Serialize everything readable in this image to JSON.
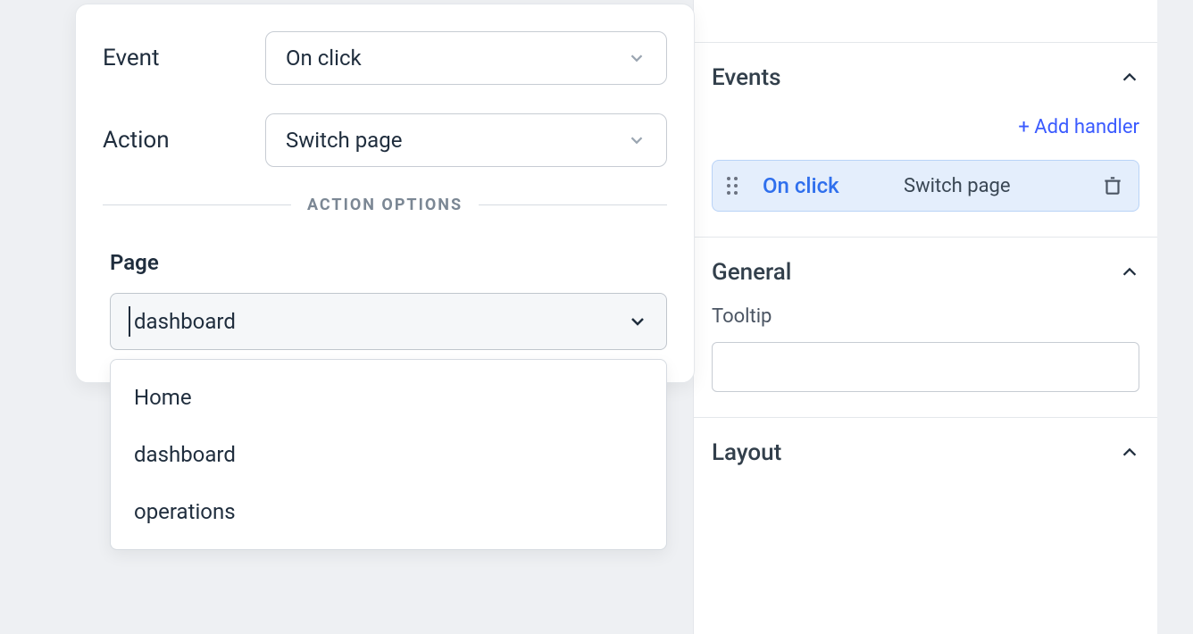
{
  "popover": {
    "event_label": "Event",
    "event_value": "On click",
    "action_label": "Action",
    "action_value": "Switch page",
    "divider_label": "ACTION OPTIONS",
    "page_label": "Page",
    "page_value": "dashboard",
    "page_options": [
      {
        "label": "Home"
      },
      {
        "label": "dashboard"
      },
      {
        "label": "operations"
      }
    ]
  },
  "inspector": {
    "events": {
      "title": "Events",
      "add_handler_label": "+ Add handler",
      "handler": {
        "event": "On click",
        "action": "Switch page"
      }
    },
    "general": {
      "title": "General",
      "tooltip_label": "Tooltip",
      "tooltip_value": ""
    },
    "layout": {
      "title": "Layout"
    }
  }
}
